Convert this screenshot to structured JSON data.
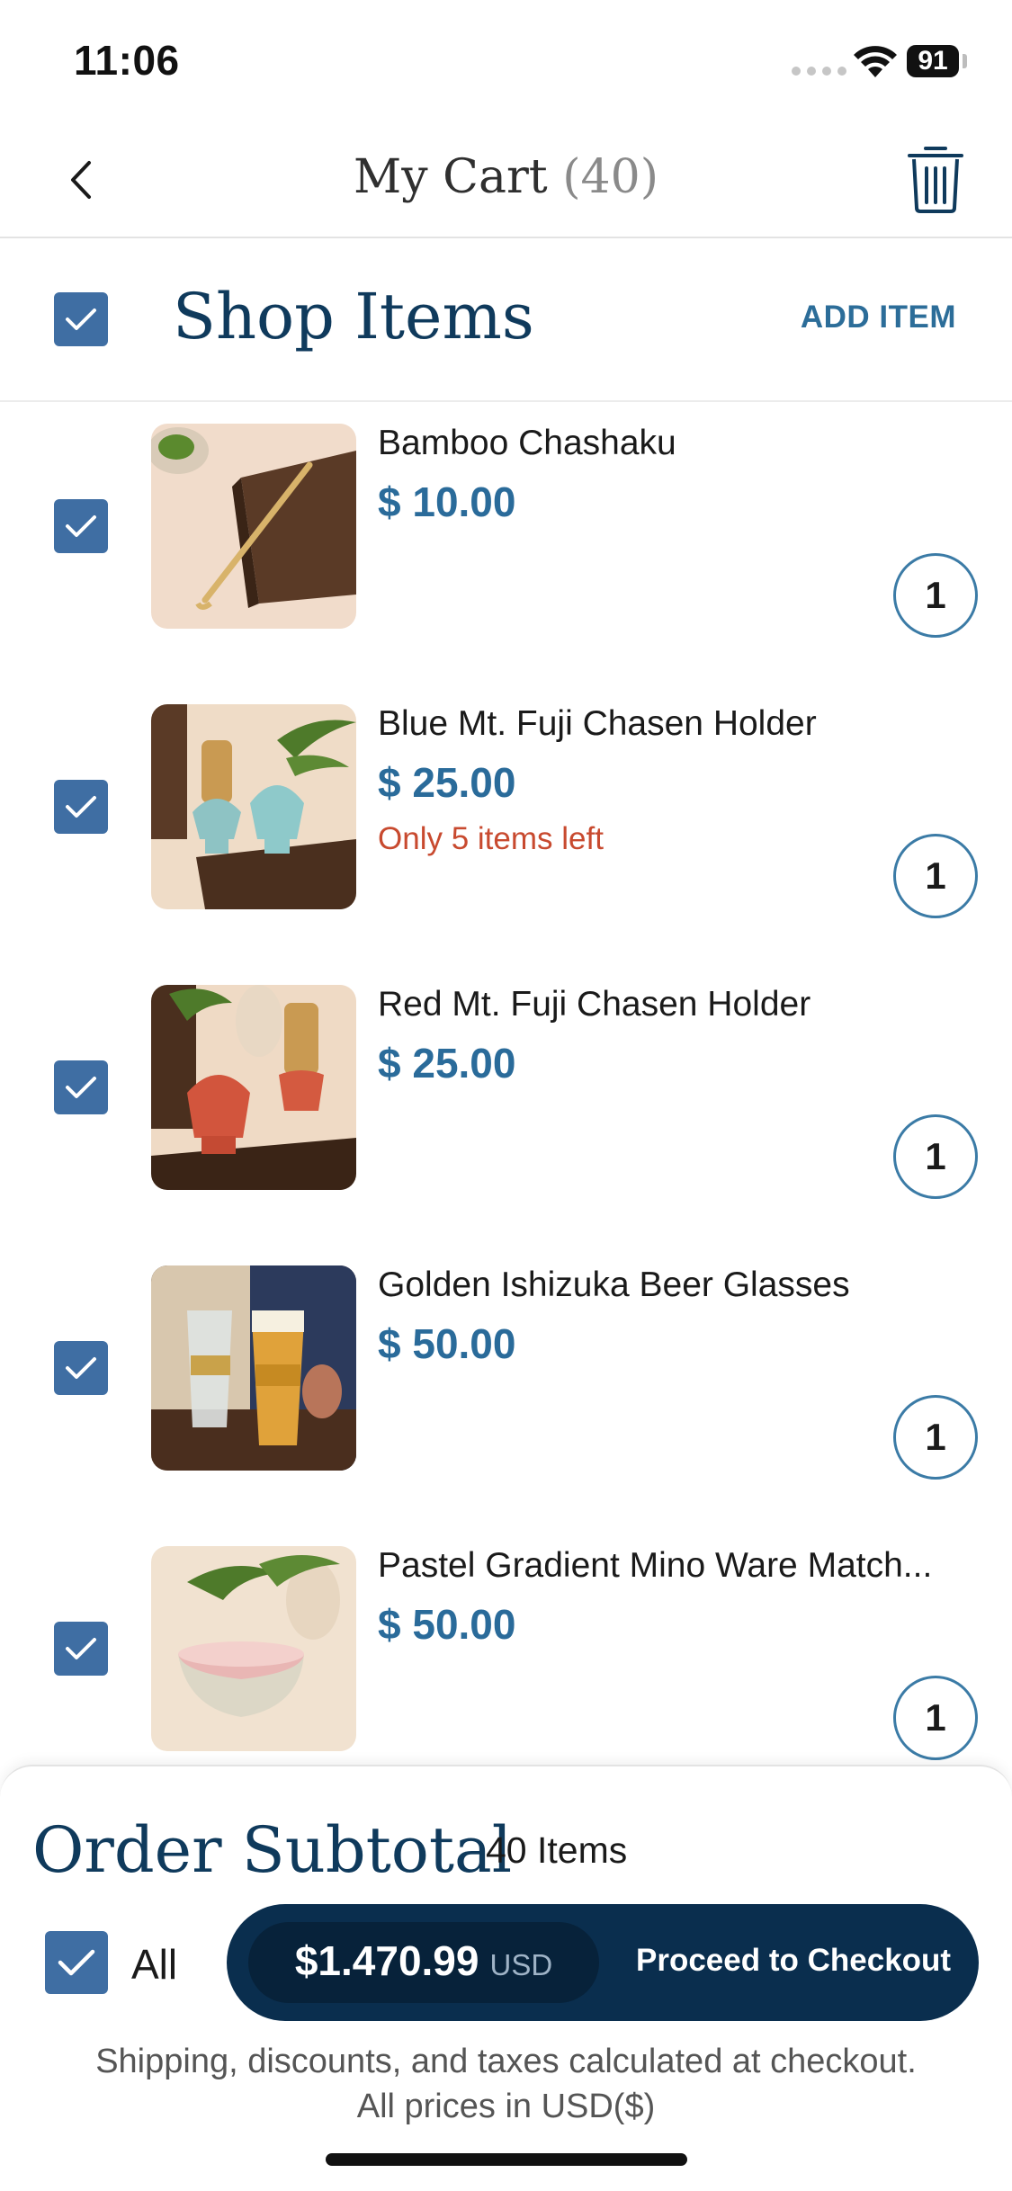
{
  "status_bar": {
    "time": "11:06",
    "battery": "91"
  },
  "nav": {
    "title": "My Cart",
    "count": "(40)"
  },
  "shop": {
    "title": "Shop Items",
    "add_item": "ADD ITEM"
  },
  "items": [
    {
      "name": "Bamboo Chashaku",
      "price": "$ 10.00",
      "stock": "",
      "qty": "1"
    },
    {
      "name": "Blue Mt. Fuji Chasen Holder",
      "price": "$ 25.00",
      "stock": "Only 5 items left",
      "qty": "1"
    },
    {
      "name": "Red Mt. Fuji Chasen Holder",
      "price": "$ 25.00",
      "stock": "",
      "qty": "1"
    },
    {
      "name": "Golden Ishizuka Beer Glasses",
      "price": "$ 50.00",
      "stock": "",
      "qty": "1"
    },
    {
      "name": "Pastel Gradient Mino Ware Match...",
      "price": "$ 50.00",
      "stock": "",
      "qty": "1"
    }
  ],
  "footer": {
    "subtotal_title": "Order Subtotal",
    "subtotal_count": "40 Items",
    "all_label": "All",
    "total_amount": "$1.470.99",
    "total_currency": "USD",
    "checkout_label": "Proceed to Checkout",
    "note_line1": "Shipping, discounts, and taxes calculated at checkout.",
    "note_line2": "All prices in USD($)"
  },
  "colors": {
    "accent": "#2a6b9a",
    "navy": "#0a2e4e",
    "checkbox": "#3f6ea3",
    "warning": "#c84a2f"
  }
}
